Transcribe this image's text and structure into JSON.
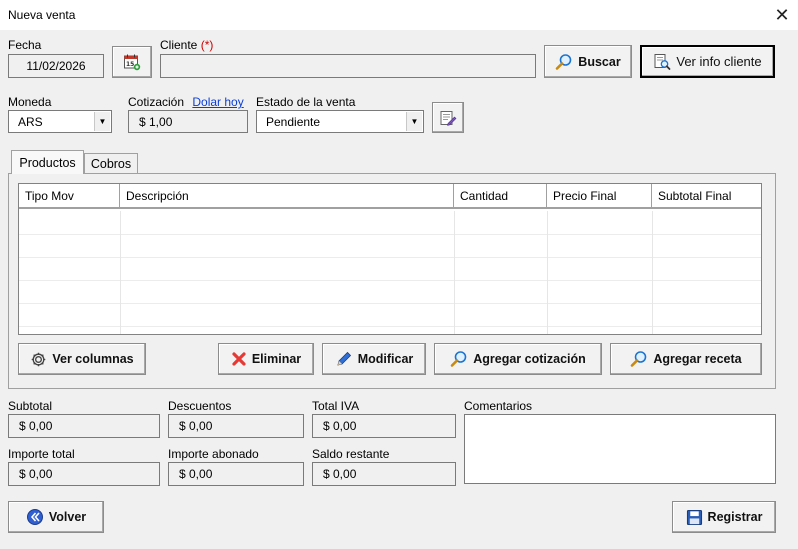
{
  "window": {
    "title": "Nueva venta",
    "close_icon": "close-icon"
  },
  "fecha": {
    "label": "Fecha",
    "value": "11/02/2026"
  },
  "cliente": {
    "label": "Cliente",
    "required_mark": "(*)",
    "value": ""
  },
  "buttons": {
    "buscar": "Buscar",
    "ver_info_cliente": "Ver info cliente",
    "ver_columnas": "Ver columnas",
    "eliminar": "Eliminar",
    "modificar": "Modificar",
    "agregar_cotizacion": "Agregar cotización",
    "agregar_receta": "Agregar receta",
    "volver": "Volver",
    "registrar": "Registrar"
  },
  "moneda": {
    "label": "Moneda",
    "selected": "ARS"
  },
  "cotizacion": {
    "label": "Cotización",
    "link": "Dolar hoy",
    "value": "$ 1,00"
  },
  "estado": {
    "label": "Estado de la venta",
    "selected": "Pendiente"
  },
  "tabs": [
    {
      "label": "Productos",
      "active": true
    },
    {
      "label": "Cobros",
      "active": false
    }
  ],
  "grid": {
    "columns": [
      "Tipo Mov",
      "Descripción",
      "Cantidad",
      "Precio Final",
      "Subtotal Final"
    ],
    "rows": []
  },
  "totals": {
    "subtotal": {
      "label": "Subtotal",
      "value": "$ 0,00"
    },
    "descuentos": {
      "label": "Descuentos",
      "value": "$ 0,00"
    },
    "total_iva": {
      "label": "Total IVA",
      "value": "$ 0,00"
    },
    "importe_total": {
      "label": "Importe total",
      "value": "$ 0,00"
    },
    "importe_abonado": {
      "label": "Importe abonado",
      "value": "$ 0,00"
    },
    "saldo_restante": {
      "label": "Saldo restante",
      "value": "$ 0,00"
    }
  },
  "comentarios": {
    "label": "Comentarios",
    "value": ""
  },
  "colors": {
    "required": "#d00000",
    "link": "#0a3dd8",
    "background": "#f0f0f0"
  }
}
